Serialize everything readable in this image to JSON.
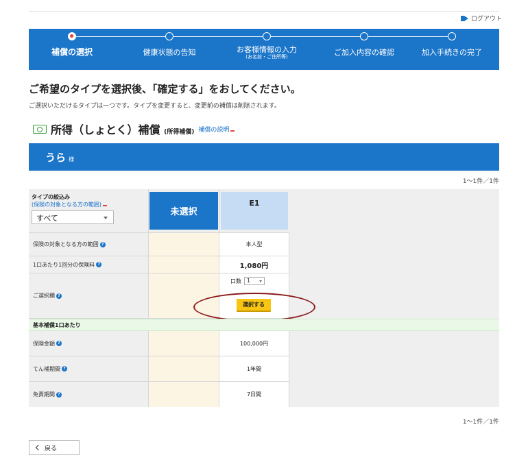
{
  "header": {
    "logout_label": "ログアウト"
  },
  "steps": [
    {
      "label": "補償の選択",
      "active": true
    },
    {
      "label": "健康状態の告知"
    },
    {
      "label": "お客様情報の入力",
      "sub": "(お名前・ご住所等)"
    },
    {
      "label": "ご加入内容の確認"
    },
    {
      "label": "加入手続きの完了"
    }
  ],
  "headline": "ご希望のタイプを選択後、「確定する」をおしてください。",
  "subtext": "ご選択いただけるタイプは一つです。タイプを変更すると、変更前の補償は削除されます。",
  "section": {
    "title": "所得（しょとく）補償",
    "title_small": "(所得補償)",
    "link": "補償の説明"
  },
  "namebar": {
    "name": "うら",
    "suffix": "様"
  },
  "count_top": "1〜1件／1件",
  "count_bottom": "1〜1件／1件",
  "filter": {
    "title": "タイプの絞込み",
    "link": "(保険の対象となる方の範囲)",
    "selected": "すべて"
  },
  "columns": {
    "unselected": "未選択",
    "plan": "E1"
  },
  "rows": {
    "coverage_scope": {
      "label": "保険の対象となる方の範囲",
      "value": "本人型"
    },
    "premium": {
      "label": "1口あたり1回分の保険料",
      "value": "1,080円"
    },
    "selection": {
      "label": "ご選択欄",
      "qty_label": "口数",
      "qty_value": "1",
      "button": "選択する"
    },
    "basic_header": "基本補償1口あたり",
    "amount": {
      "label": "保険金額",
      "value": "100,000円"
    },
    "period": {
      "label": "てん補期間",
      "value": "1年間"
    },
    "exempt": {
      "label": "免責期間",
      "value": "7日間"
    }
  },
  "back_button": "戻る",
  "colors": {
    "brand_blue": "#1b75c9",
    "select_yellow": "#f7c512",
    "highlight_oval": "#8b1a1a"
  }
}
